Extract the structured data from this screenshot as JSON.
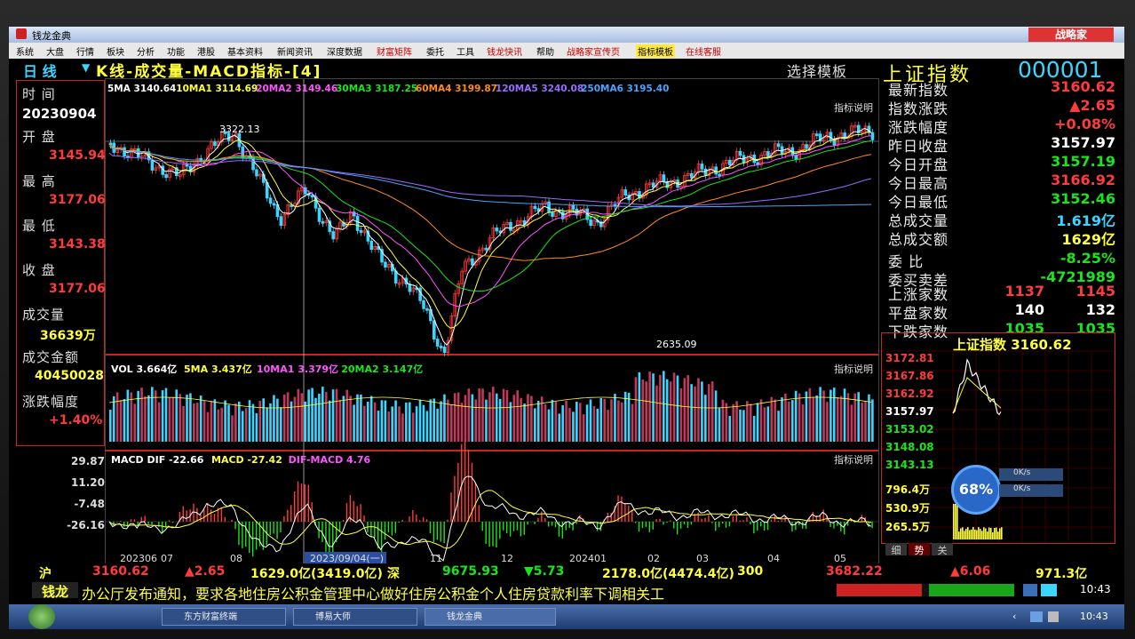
{
  "window": {
    "title": "钱龙金典",
    "brand": "战略家"
  },
  "menu": [
    "系统",
    "大盘",
    "行情",
    "板块",
    "分析",
    "功能",
    "港股",
    "基本资料",
    "新闻资讯",
    "深度数据",
    "财富矩阵",
    "委托",
    "工具",
    "钱龙快讯",
    "帮助",
    "战略家宣传页",
    "指标模板",
    "在线客服"
  ],
  "chart_title": {
    "period": "日 线",
    "title": "K线-成交量-MACD指标-[4]",
    "template": "选择模板",
    "indicator_help": "指标说明"
  },
  "ma_legend": [
    {
      "label": "5MA 3140.64",
      "color": "#ffffff"
    },
    {
      "label": "10MA1 3114.69",
      "color": "#ffff3b"
    },
    {
      "label": "20MA2 3149.46",
      "color": "#ff55ff"
    },
    {
      "label": "30MA3 3187.25",
      "color": "#19e619"
    },
    {
      "label": "60MA4 3199.87",
      "color": "#ff8c1a"
    },
    {
      "label": "120MA5 3240.08",
      "color": "#9a6bff"
    },
    {
      "label": "250MA6 3195.40",
      "color": "#4aa3ff"
    }
  ],
  "left_panel": {
    "time_label": "时 间",
    "time_value": "20230904",
    "open_label": "开 盘",
    "open_value": "3145.94",
    "high_label": "最 高",
    "high_value": "3177.06",
    "low_label": "最 低",
    "low_value": "3143.38",
    "close_label": "收 盘",
    "close_value": "3177.06",
    "vol_label": "成交量",
    "vol_value": "36639万",
    "amount_label": "成交金额",
    "amount_value": "40450028",
    "change_label": "涨跌幅度",
    "change_value": "+1.40%"
  },
  "kline": {
    "high_marker": "3322.13",
    "low_marker": "2635.09"
  },
  "volume": {
    "legend": [
      "VOL 3.664亿",
      "5MA 3.437亿",
      "10MA1 3.379亿",
      "20MA2 3.147亿"
    ]
  },
  "macd": {
    "legend": [
      "MACD DIF -22.66",
      "MACD -27.42",
      "DIF-MACD 4.76"
    ],
    "yticks": [
      "29.87",
      "11.20",
      "-7.48",
      "-26.16"
    ]
  },
  "x_axis": {
    "labels": [
      "202306",
      "07",
      "08",
      "2023/09/04(一)",
      "11",
      "12",
      "202401",
      "02",
      "03",
      "04",
      "05"
    ]
  },
  "right_panel": {
    "index_name": "上证指数",
    "index_code": "000001",
    "rows": [
      {
        "label": "最新指数",
        "value": "3160.62",
        "color": "red"
      },
      {
        "label": "指数涨跌",
        "value": "▲2.65",
        "color": "red"
      },
      {
        "label": "涨跌幅度",
        "value": "+0.08%",
        "color": "red"
      },
      {
        "label": "昨日收盘",
        "value": "3157.97",
        "color": "wh"
      },
      {
        "label": "今日开盘",
        "value": "3157.19",
        "color": "grn"
      },
      {
        "label": "今日最高",
        "value": "3166.92",
        "color": "red"
      },
      {
        "label": "今日最低",
        "value": "3152.46",
        "color": "grn"
      },
      {
        "label": "总成交量",
        "value": "1.619亿",
        "color": "cy"
      },
      {
        "label": "总成交额",
        "value": "1629亿",
        "color": "yel"
      },
      {
        "label": "委 比",
        "value": "-8.25%",
        "color": "grn"
      },
      {
        "label": "委买卖差",
        "value": "-4721989",
        "color": "grn"
      }
    ],
    "counts": [
      {
        "label": "上涨家数",
        "a": "1137",
        "b": "1145",
        "color": "red"
      },
      {
        "label": "平盘家数",
        "a": "140",
        "b": "132",
        "color": "wh"
      },
      {
        "label": "下跌家数",
        "a": "1035",
        "b": "1035",
        "color": "grn"
      }
    ]
  },
  "mini_chart": {
    "title": "上证指数 3160.62",
    "prices": [
      "3172.81",
      "3167.86",
      "3162.92",
      "3157.97",
      "3153.02",
      "3148.08",
      "3143.13"
    ],
    "vols": [
      "796.4万",
      "530.9万",
      "265.5万"
    ],
    "gauge": "68%",
    "speed1": "0K/s",
    "speed2": "0K/s",
    "tabs": [
      "细",
      "势",
      "关"
    ]
  },
  "status_bar": {
    "sh_label": "沪",
    "sh_value": "3160.62",
    "sh_change": "▲2.65",
    "sh_amount": "1629.0亿(3419.0亿)",
    "sz_label": "深",
    "sz_value": "9675.93",
    "sz_change": "▼5.73",
    "sz_amount": "2178.0亿(4474.4亿)",
    "c300_label": "300",
    "c300_value": "3682.22",
    "c300_change": "▲6.06",
    "c300_amount": "971.3亿"
  },
  "ticker": {
    "label": "钱龙",
    "text": "办公厅发布通知，要求各地住房公积金管理中心做好住房公积金个人住房贷款利率下调相关工",
    "time": "10:43"
  },
  "taskbar": {
    "tasks": [
      "东方财富终端",
      "博易大师",
      "钱龙金典"
    ],
    "time": "10:43"
  }
}
